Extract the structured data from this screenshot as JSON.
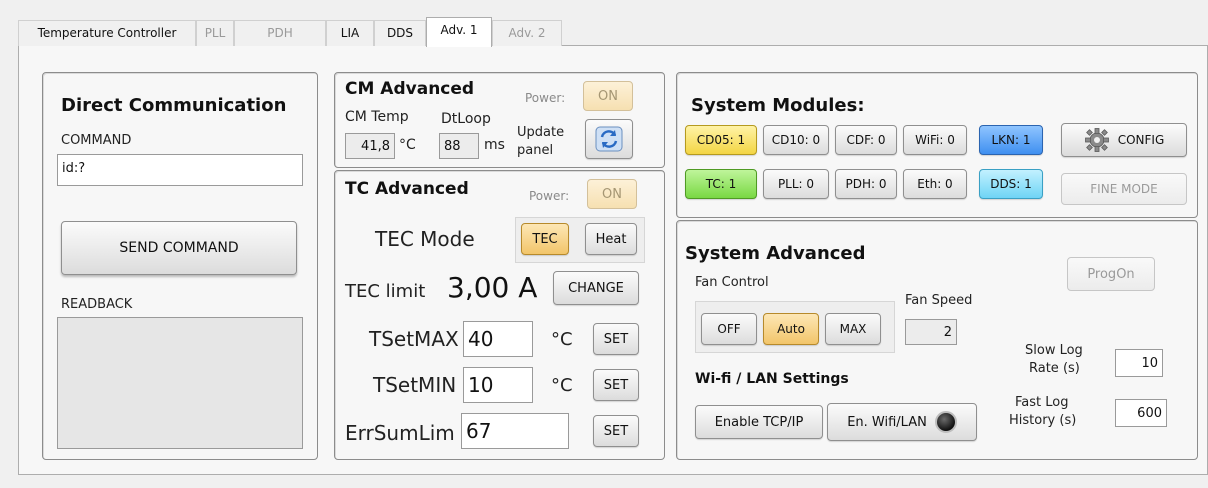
{
  "tabs": [
    {
      "label": "Temperature Controller",
      "state": "normal"
    },
    {
      "label": "PLL",
      "state": "dim"
    },
    {
      "label": "PDH",
      "state": "dim"
    },
    {
      "label": "LIA",
      "state": "normal"
    },
    {
      "label": "DDS",
      "state": "normal"
    },
    {
      "label": "Adv. 1",
      "state": "active"
    },
    {
      "label": "Adv. 2",
      "state": "dim"
    }
  ],
  "direct": {
    "title": "Direct Communication",
    "command_label": "COMMAND",
    "command_value": "id:?",
    "send_label": "SEND COMMAND",
    "readback_label": "READBACK",
    "readback_value": ""
  },
  "cm": {
    "title": "CM Advanced",
    "power_label": "Power:",
    "power_button": "ON",
    "cmtemp_label": "CM Temp",
    "dtloop_label": "DtLoop",
    "cmtemp_value": "41,8",
    "cmtemp_unit": "°C",
    "dtloop_value": "88",
    "dtloop_unit": "ms",
    "update_label_1": "Update",
    "update_label_2": "panel"
  },
  "tc": {
    "title": "TC Advanced",
    "power_label": "Power:",
    "power_button": "ON",
    "tec_mode_label": "TEC Mode",
    "tec_button": "TEC",
    "heat_button": "Heat",
    "tec_limit_label": "TEC limit",
    "tec_limit_value": "3,00 A",
    "change_button": "CHANGE",
    "tsetmax_label": "TSetMAX",
    "tsetmax_value": "40",
    "tsetmax_unit": "°C",
    "tsetmin_label": "TSetMIN",
    "tsetmin_value": "10",
    "tsetmin_unit": "°C",
    "errsum_label": "ErrSumLim",
    "errsum_value": "67",
    "set_label": "SET"
  },
  "modules": {
    "title": "System Modules:",
    "row1": [
      {
        "label": "CD05: 1",
        "color": "yellow"
      },
      {
        "label": "CD10: 0",
        "color": "gray"
      },
      {
        "label": "CDF: 0",
        "color": "gray"
      },
      {
        "label": "WiFi: 0",
        "color": "gray"
      },
      {
        "label": "LKN: 1",
        "color": "blue"
      }
    ],
    "row2": [
      {
        "label": "TC: 1",
        "color": "green"
      },
      {
        "label": "PLL: 0",
        "color": "gray"
      },
      {
        "label": "PDH: 0",
        "color": "gray"
      },
      {
        "label": "Eth: 0",
        "color": "gray"
      },
      {
        "label": "DDS: 1",
        "color": "cyan"
      }
    ],
    "config_button": "CONFIG",
    "fine_mode_button": "FINE MODE"
  },
  "sysadv": {
    "title": "System Advanced",
    "progon_button": "ProgOn",
    "fan_control_label": "Fan Control",
    "fan_off": "OFF",
    "fan_auto": "Auto",
    "fan_max": "MAX",
    "fan_speed_label": "Fan Speed",
    "fan_speed_value": "2",
    "wifi_title": "Wi-fi / LAN Settings",
    "enable_tcp": "Enable TCP/IP",
    "en_wifi": "En. Wifi/LAN",
    "slow_log_label_1": "Slow Log",
    "slow_log_label_2": "Rate (s)",
    "slow_log_value": "10",
    "fast_log_label_1": "Fast Log",
    "fast_log_label_2": "History (s)",
    "fast_log_value": "600"
  }
}
